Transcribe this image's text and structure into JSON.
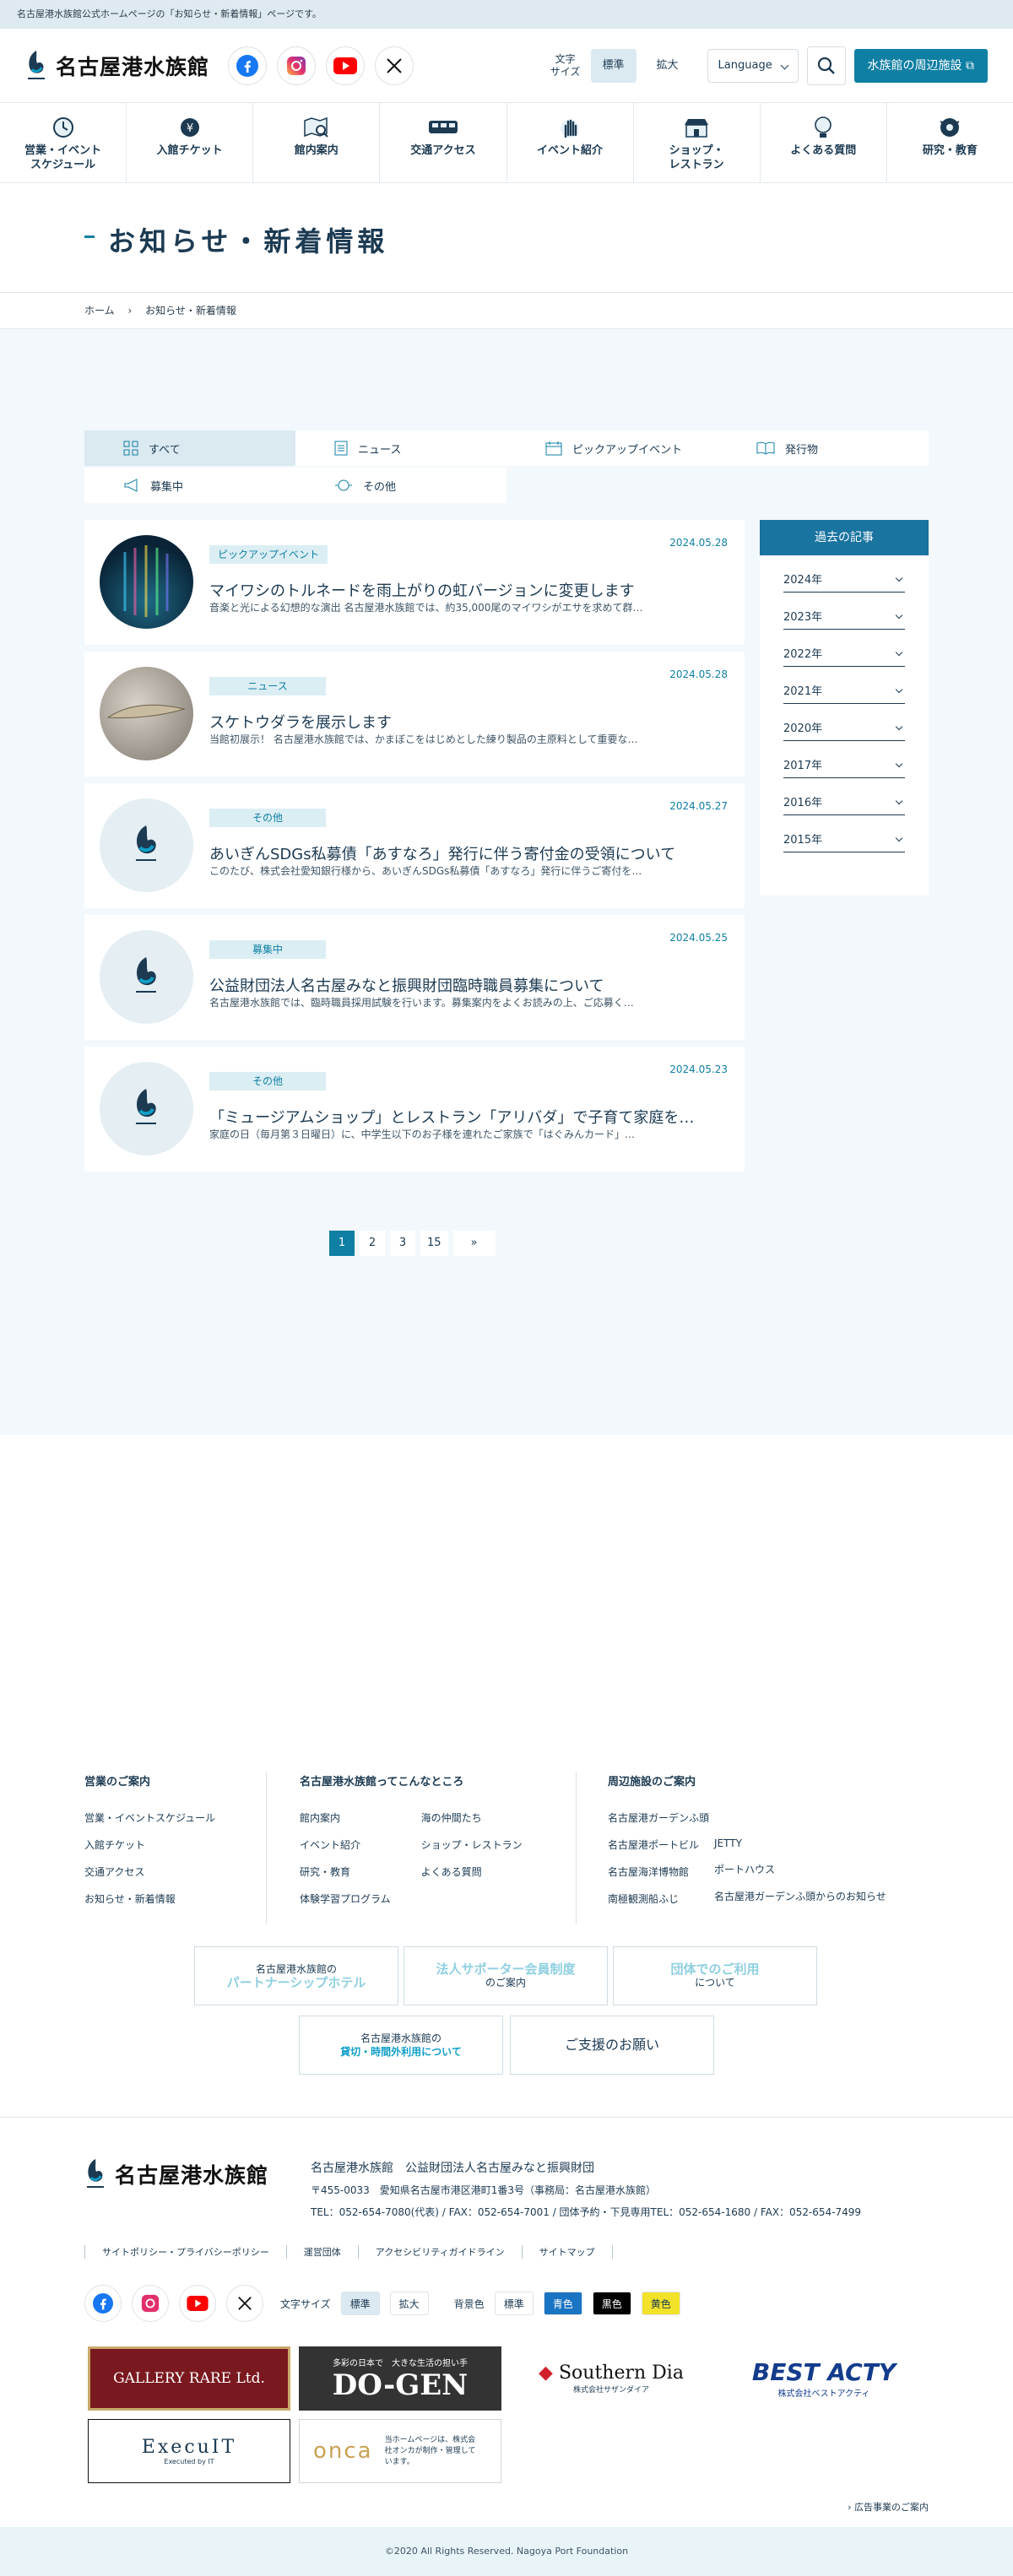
{
  "topbar": {
    "note": "名古屋港水族館公式ホームページの「お知らせ・新着情報」ページです。"
  },
  "header": {
    "logo_text": "名古屋港水族館",
    "font_size_label_1": "文字",
    "font_size_label_2": "サイズ",
    "font_standard": "標準",
    "font_large": "拡大",
    "language": "Language",
    "cta": "水族館の周辺施設"
  },
  "nav": [
    {
      "label": "営業・イベント\nスケジュール",
      "icon": "clock-icon"
    },
    {
      "label": "入館チケット",
      "icon": "yen-icon"
    },
    {
      "label": "館内案内",
      "icon": "map-icon"
    },
    {
      "label": "交通アクセス",
      "icon": "bus-icon"
    },
    {
      "label": "イベント紹介",
      "icon": "hand-icon"
    },
    {
      "label": "ショップ・\nレストラン",
      "icon": "shop-icon"
    },
    {
      "label": "よくある質問",
      "icon": "bulb-icon"
    },
    {
      "label": "研究・教育",
      "icon": "research-icon"
    }
  ],
  "page": {
    "title": "お知らせ・新着情報"
  },
  "breadcrumb": {
    "home": "ホーム",
    "current": "お知らせ・新着情報"
  },
  "categories": [
    {
      "label": "すべて",
      "icon": "grid-icon"
    },
    {
      "label": "ニュース",
      "icon": "document-icon"
    },
    {
      "label": "ピックアップイベント",
      "icon": "calendar-icon"
    },
    {
      "label": "発行物",
      "icon": "book-icon"
    },
    {
      "label": "募集中",
      "icon": "megaphone-icon"
    },
    {
      "label": "その他",
      "icon": "circle-arrows-icon"
    }
  ],
  "posts": [
    {
      "tag": "ピックアップイベント",
      "date": "2024.05.28",
      "title": "マイワシのトルネードを雨上がりの虹バージョンに変更します",
      "desc": "音楽と光による幻想的な演出 名古屋港水族館では、約35,000尾のマイワシがエサを求めて群…",
      "thumb": "sardine"
    },
    {
      "tag": "ニュース",
      "date": "2024.05.28",
      "title": "スケトウダラを展示します",
      "desc": "当館初展示！ 名古屋港水族館では、かまぼこをはじめとした練り製品の主原料として重要な…",
      "thumb": "pollock"
    },
    {
      "tag": "その他",
      "date": "2024.05.27",
      "title": "あいぎんSDGs私募債「あすなろ」発行に伴う寄付金の受領について",
      "desc": "このたび、株式会社愛知銀行様から、あいぎんSDGs私募債「あすなろ」発行に伴うご寄付を…",
      "thumb": "logo"
    },
    {
      "tag": "募集中",
      "date": "2024.05.25",
      "title": "公益財団法人名古屋みなと振興財団臨時職員募集について",
      "desc": "名古屋港水族館では、臨時職員採用試験を行います。募集案内をよくお読みの上、ご応募く…",
      "thumb": "logo"
    },
    {
      "tag": "その他",
      "date": "2024.05.23",
      "title": "「ミュージアムショップ」とレストラン「アリバダ」で子育て家庭を…",
      "desc": "家庭の日（毎月第３日曜日）に、中学生以下のお子様を連れたご家族で「はぐみんカード」…",
      "thumb": "logo"
    }
  ],
  "archive": {
    "heading": "過去の記事",
    "years": [
      "2024年",
      "2023年",
      "2022年",
      "2021年",
      "2020年",
      "2017年",
      "2016年",
      "2015年"
    ]
  },
  "pager": [
    "1",
    "2",
    "3",
    "15",
    "»"
  ],
  "footer": {
    "col1": {
      "heading": "営業のご案内",
      "links": [
        "営業・イベントスケジュール",
        "入館チケット",
        "交通アクセス",
        "お知らせ・新着情報"
      ]
    },
    "col2": {
      "heading": "名古屋港水族館ってこんなところ",
      "links_a": [
        "館内案内",
        "イベント紹介",
        "研究・教育",
        "体験学習プログラム"
      ],
      "links_b": [
        "海の仲間たち",
        "ショップ・レストラン",
        "よくある質問"
      ]
    },
    "col3": {
      "heading": "周辺施設のご案内",
      "main": "名古屋港ガーデンふ頭",
      "links_a": [
        "名古屋港ポートビル",
        "名古屋海洋博物館",
        "南極観測船ふじ"
      ],
      "links_b": [
        "JETTY",
        "ポートハウス",
        "名古屋港ガーデンふ頭からのお知らせ"
      ]
    },
    "banners": [
      {
        "l1": "名古屋港水族館の",
        "l2": "パートナーシップホテル"
      },
      {
        "l1": "法人サポーター会員制度",
        "l2": "のご案内"
      },
      {
        "l1": "団体でのご利用",
        "l2": "について"
      },
      {
        "l1": "名古屋港水族館の",
        "l2": "貸切・時間外利用について"
      },
      {
        "l1": "",
        "l2": "ご支援のお願い"
      }
    ],
    "org_1": "名古屋港水族館",
    "org_2": "公益財団法人名古屋みなと振興財団",
    "postal": "〒455-0033　愛知県名古屋市港区港町1番3号（事務局：名古屋港水族館）",
    "tel": "TEL：052-654-7080(代表) / FAX：052-654-7001 / 団体予約・下見専用TEL：052-654-1680 / FAX：052-654-7499",
    "links": [
      "サイトポリシー・プライバシーポリシー",
      "運営団体",
      "アクセシビリティガイドライン",
      "サイトマップ"
    ],
    "tool_font": "文字サイズ",
    "tool_std": "標準",
    "tool_large": "拡大",
    "tool_bg": "背景色",
    "bg_std": "標準",
    "bg_blue": "青色",
    "bg_black": "黒色",
    "bg_yellow": "黄色",
    "ads": [
      "GALLERY RARE Ltd.",
      "DO-GEN",
      "Southern Dia",
      "BEST ACTY",
      "ExecuIT",
      "onca"
    ],
    "ad_dogen_sub": "多彩の日本で　大きな生活の担い手",
    "ad_southern_sub": "株式会社サザンダイア",
    "ad_best_sub": "株式会社ベストアクティ",
    "ad_exec_sub": "Executed by IT",
    "ad_onca_sub": "当ホームページは、株式会社オンカが制作・管理しています。",
    "ad_link": "広告事業のご案内",
    "copyright": "©2020 All Rights Reserved. Nagoya Port Foundation"
  },
  "colors": {
    "accent": "#0f7fa3",
    "navy": "#1c3a52",
    "pale": "#f2f8fb"
  }
}
